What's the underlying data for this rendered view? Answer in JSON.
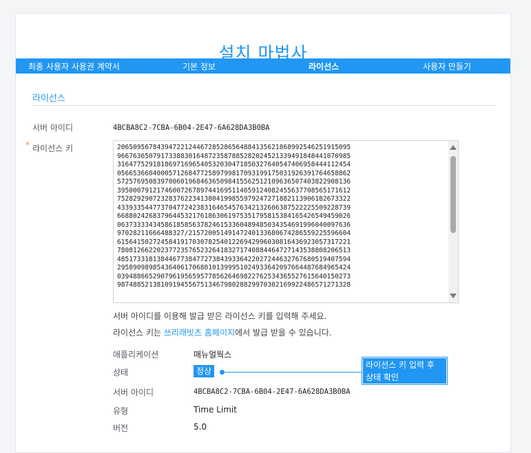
{
  "wizard": {
    "title": "설치 마법사",
    "steps": [
      {
        "label": "최종 사용자 사용권 계약서"
      },
      {
        "label": "기본 정보"
      },
      {
        "label": "라이선스"
      },
      {
        "label": "사용자 만들기"
      }
    ]
  },
  "license": {
    "section_title": "라이선스",
    "server_id_label": "서버 아이디",
    "server_id": "4BCBA8C2-7CBA-6B04-2E47-6A628DA3B0BA",
    "required_mark": "*",
    "key_label": "라이선스 키",
    "key_lines": [
      "20650956784394722124467285286564884135621868992546251915095",
      "96676365079173388301648723587885282024521339491848441070985",
      "31647752918186971696540532030471850327640547406958444112454",
      "05665366040005712684772589799817093199175031926391764658862",
      "57257695083970060196846365098415562512109636507403822908136",
      "39500079121746007267897441695114659124082455637708565171612",
      "75282929072328376223413804199855979247271882113906182673322",
      "43393354477370477242383164654576342132606387522225509228739",
      "66880242683796445321761863061975351795815384165426549459026",
      "06373333434586185856378246153360489485034354691996040097636",
      "97028211666488327/21572005149147240133680674286559225596604",
      "61564150272458419170307825401226942996030816436923057317221",
      "78081266220237723576523264183271740884464727143538808206513",
      "48517331813844677384772738439336422027244632767680519407594",
      "29589098985436406170680101399951024933642097664487684965424",
      "03948866529079619565957785626469822762534365527615640150273",
      "98748852138109194556751346798028829970302169922486571271328"
    ],
    "help_line1": "서버 아이디를 이용해 발급 받은 라이선스 키를 입력해 주세요.",
    "help_line2_prefix": "라이선스 키는 ",
    "help_line2_link": "쓰리래빗츠 홈페이지",
    "help_line2_suffix": "에서 발급 받을 수 있습니다."
  },
  "info": {
    "app_label": "애플리케이션",
    "app_value": "매뉴얼웍스",
    "status_label": "상태",
    "status_value": "정상",
    "server_id_label": "서버 아이디",
    "server_id_value": "4BCBA8C2-7CBA-6B04-2E47-6A628DA3B0BA",
    "type_label": "유형",
    "type_value": "Time Limit",
    "version_label": "버전",
    "version_value": "5.0"
  },
  "callout": {
    "line1": "라이선스 키 입력 후",
    "line2": "상태 확인"
  },
  "colors": {
    "accent": "#2196f3",
    "required": "#f08c3c"
  }
}
